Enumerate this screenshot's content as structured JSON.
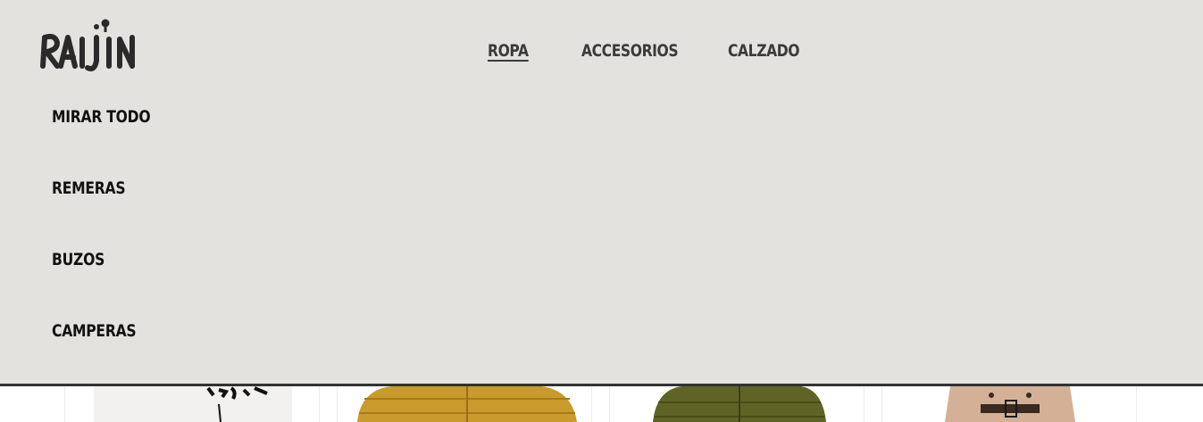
{
  "brand": {
    "logo_text": "RAIJIN"
  },
  "nav": {
    "items": [
      {
        "label": "ROPA",
        "active": true
      },
      {
        "label": "ACCESORIOS",
        "active": false
      },
      {
        "label": "CALZADO",
        "active": false
      }
    ]
  },
  "submenu": {
    "items": [
      {
        "label": "MIRAR TODO"
      },
      {
        "label": "REMERAS"
      },
      {
        "label": "BUZOS"
      },
      {
        "label": "CAMPERAS"
      }
    ]
  },
  "products": [
    {
      "image": "white-tshirt-graphic"
    },
    {
      "image": "mustard-puffer-jacket"
    },
    {
      "image": "olive-puffer-jacket"
    },
    {
      "image": "beige-trench-coat"
    }
  ],
  "colors": {
    "menu_bg": "#e3e2de",
    "menu_border": "#333333",
    "text": "#111111",
    "nav_text": "#3a3a3a"
  }
}
